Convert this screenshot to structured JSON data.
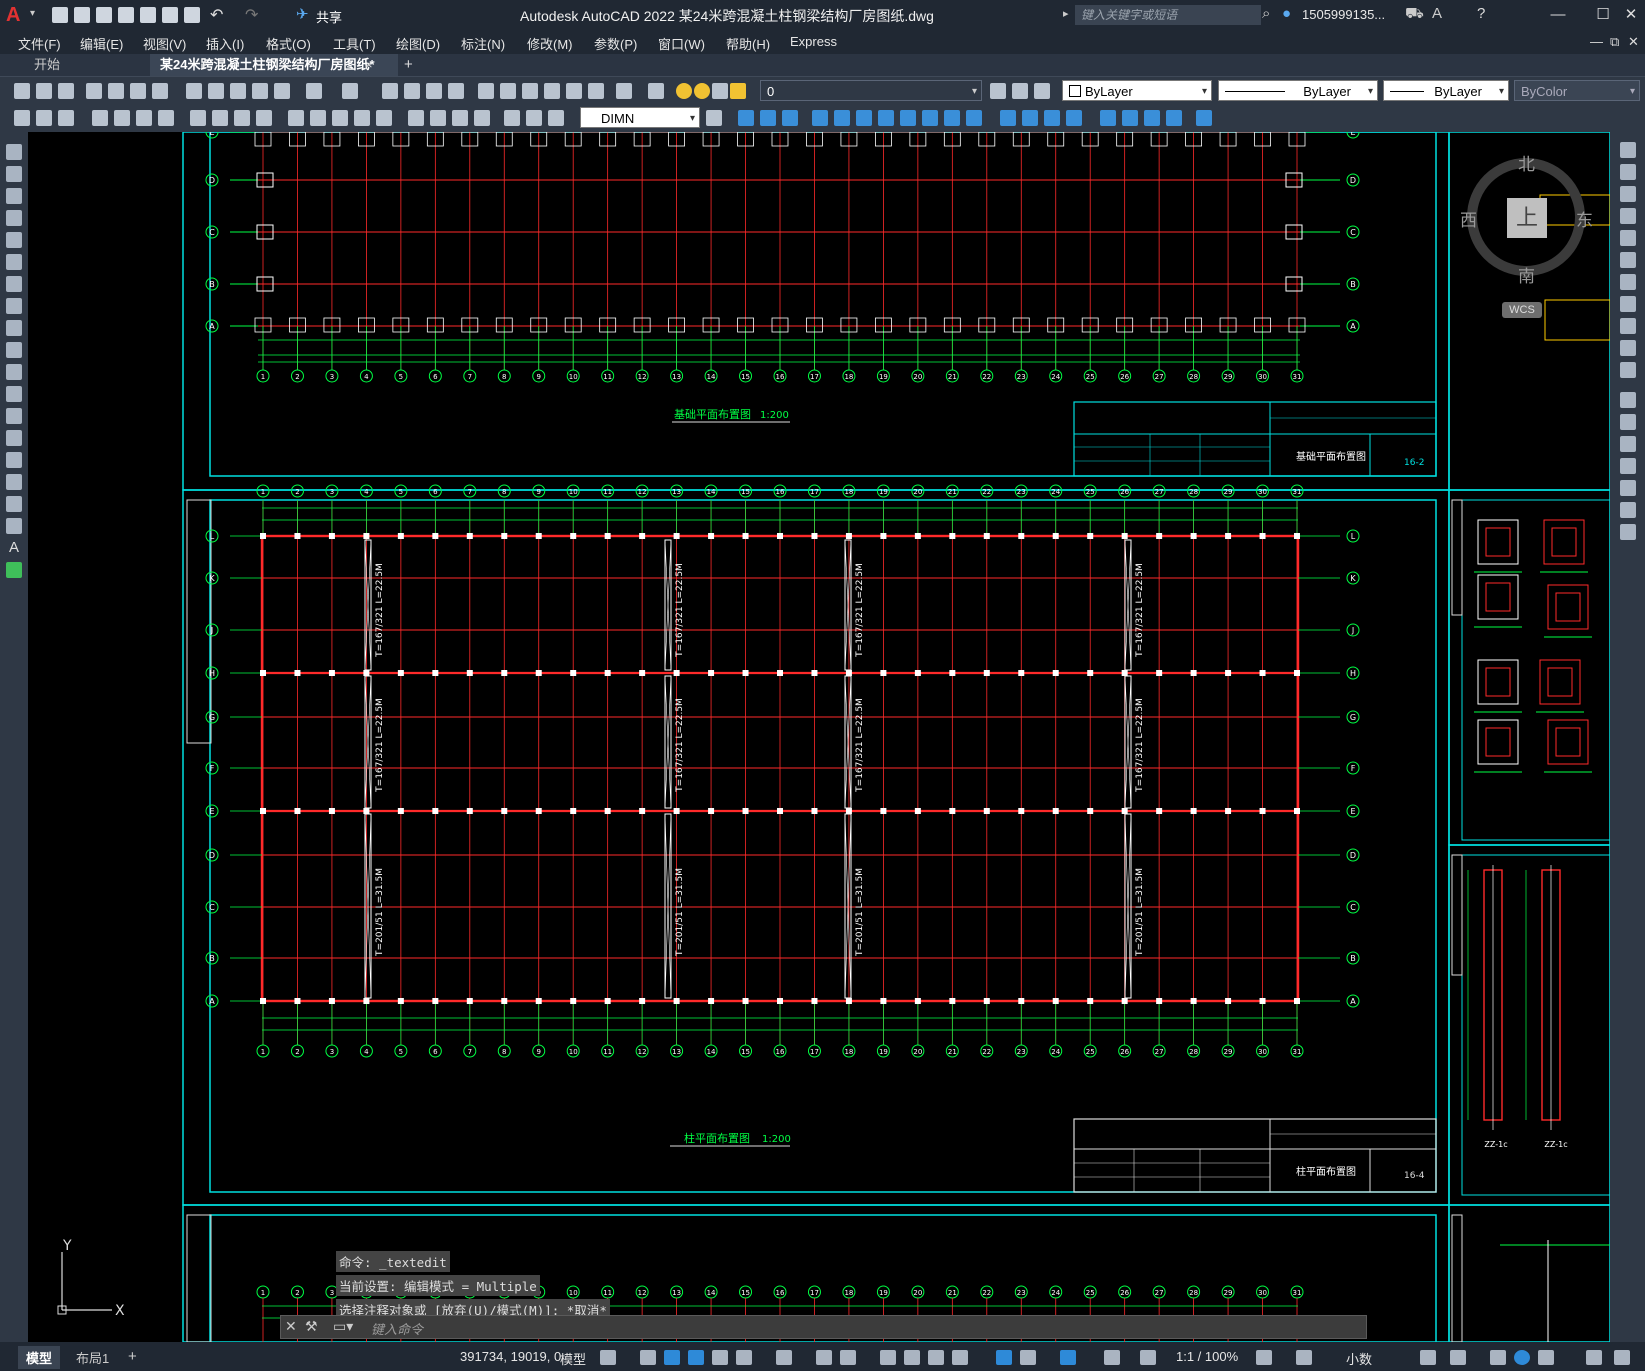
{
  "app": {
    "logo": "A",
    "title": "Autodesk AutoCAD 2022    某24米跨混凝土柱钢梁结构厂房图纸.dwg"
  },
  "search": {
    "placeholder": "键入关键字或短语"
  },
  "user": {
    "name": "1505999135...",
    "share_label": "共享"
  },
  "menus": [
    "文件(F)",
    "编辑(E)",
    "视图(V)",
    "插入(I)",
    "格式(O)",
    "工具(T)",
    "绘图(D)",
    "标注(N)",
    "修改(M)",
    "参数(P)",
    "窗口(W)",
    "帮助(H)",
    "Express"
  ],
  "tabs": {
    "start": "开始",
    "doc": "某24米跨混凝土柱钢梁结构厂房图纸*",
    "close": "×",
    "add": "+"
  },
  "toolbar": {
    "layer": "0",
    "color": "ByLayer",
    "linetype": "ByLayer",
    "lineweight": "ByLayer",
    "plotstyle": "ByColor",
    "dimstyle": "DIMN"
  },
  "viewcube": {
    "north": "北",
    "south": "南",
    "east": "东",
    "west": "西",
    "top": "上",
    "wcs": "WCS"
  },
  "drawing": {
    "plan1_title": "基础平面布置图",
    "plan1_scale": "1:200",
    "plan1_block": "基础平面布置图",
    "plan1_sheet": "16-2",
    "plan2_title": "柱平面布置图",
    "plan2_scale": "1:200",
    "plan2_block": "柱平面布置图",
    "plan2_sheet": "16-4",
    "bracing_top": "T=167/321 L=22.5M",
    "bracing_bot": "T=201/51 L=31.5M",
    "row_labels_top": [
      "E",
      "D",
      "C",
      "B",
      "A"
    ],
    "row_labels_bot": [
      "L",
      "K",
      "J",
      "H",
      "G",
      "F",
      "E",
      "D",
      "C",
      "B",
      "A"
    ],
    "col_labels": [
      "1",
      "2",
      "3",
      "4",
      "5",
      "6",
      "7",
      "8",
      "9",
      "10",
      "11",
      "12",
      "13",
      "14",
      "15",
      "16",
      "17",
      "18",
      "19",
      "20",
      "21",
      "22",
      "23",
      "24",
      "25",
      "26",
      "27",
      "28",
      "29",
      "30",
      "31"
    ],
    "detail_1": "ZZ-1c",
    "detail_2": "ZZ-1c",
    "ucs_y": "Y",
    "ucs_x": "X"
  },
  "command": {
    "history": [
      "命令: _textedit",
      "当前设置: 编辑模式 = Multiple",
      "选择注释对象或 [放弃(U)/模式(M)]: *取消*"
    ],
    "placeholder": "键入命令"
  },
  "layout_tabs": {
    "model": "模型",
    "layout1": "布局1",
    "add": "+"
  },
  "status": {
    "coords": "391734, 19019, 0",
    "model": "模型",
    "scale": "1:1 / 100%",
    "units": "小数"
  }
}
